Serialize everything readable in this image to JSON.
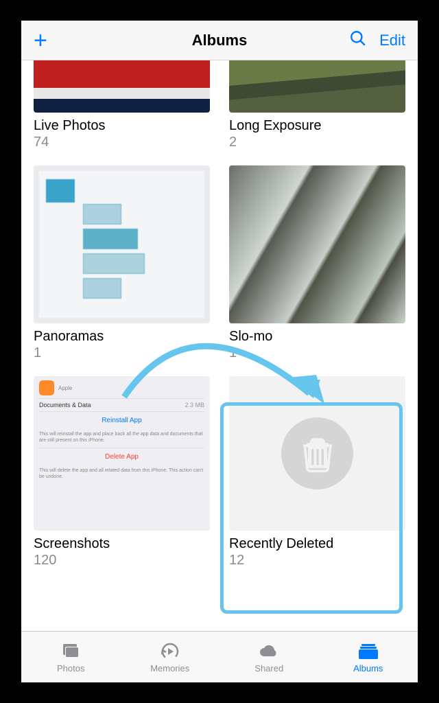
{
  "nav": {
    "title": "Albums",
    "edit_label": "Edit"
  },
  "albums": [
    {
      "title": "Live Photos",
      "count": "74"
    },
    {
      "title": "Long Exposure",
      "count": "2"
    },
    {
      "title": "Panoramas",
      "count": "1"
    },
    {
      "title": "Slo-mo",
      "count": "1"
    },
    {
      "title": "Screenshots",
      "count": "120"
    },
    {
      "title": "Recently Deleted",
      "count": "12"
    }
  ],
  "screenshot_thumb": {
    "apple_label": "Apple",
    "docs_label": "Documents & Data",
    "docs_size": "2.3 MB",
    "reinstall": "Reinstall App",
    "reinstall_sub": "This will reinstall the app and place back all the app data and documents that are still present on this iPhone.",
    "delete": "Delete App",
    "delete_sub": "This will delete the app and all related data from this iPhone. This action can't be undone."
  },
  "tabs": {
    "photos": "Photos",
    "memories": "Memories",
    "shared": "Shared",
    "albums": "Albums"
  }
}
